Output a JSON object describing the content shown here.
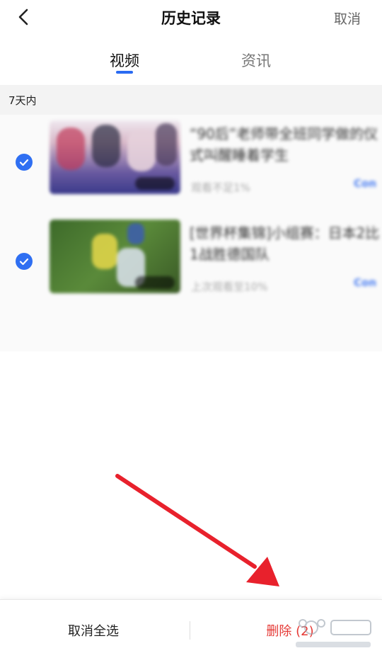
{
  "header": {
    "title": "历史记录",
    "cancel_label": "取消"
  },
  "tabs": [
    {
      "label": "视频",
      "active": true
    },
    {
      "label": "资讯",
      "active": false
    }
  ],
  "section": {
    "label": "7天内"
  },
  "items": [
    {
      "title": "“90后”老师带全班同学做的仪式叫醒睡着学生",
      "meta": "观看不足1%",
      "action": "Con",
      "checked": true
    },
    {
      "title": "[世界杯集锦]小组赛：日本2比1战胜德国队",
      "meta": "上次观看至10%",
      "action": "Con",
      "checked": true
    }
  ],
  "bottom_bar": {
    "deselect_label": "取消全选",
    "delete_label": "删除 (2)"
  },
  "colors": {
    "accent": "#2f6ff2",
    "delete": "#e53935",
    "arrow": "#e8212c"
  }
}
